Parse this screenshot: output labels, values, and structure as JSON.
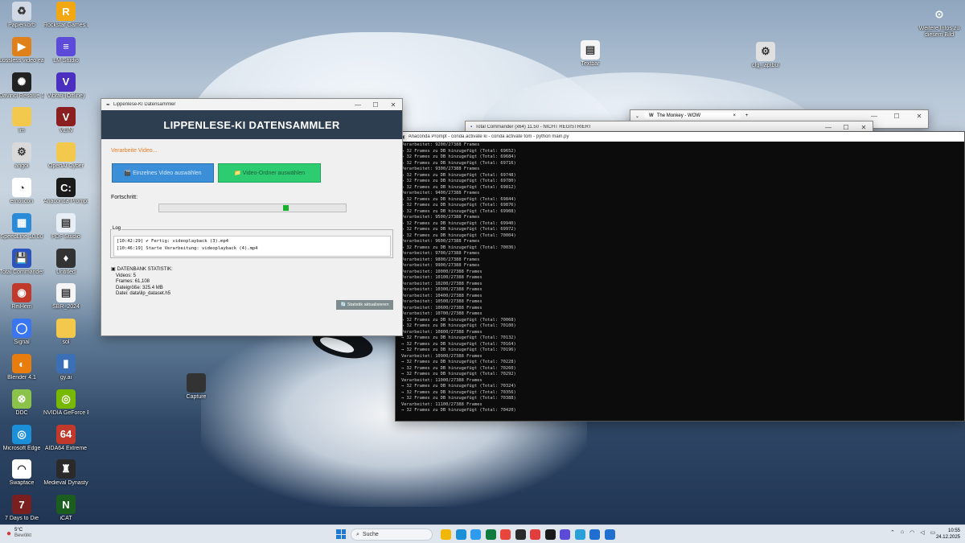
{
  "desktop": {
    "icons_left": [
      {
        "label": "Papierkorb",
        "glyph": "♻",
        "color": "#cfd8e3"
      },
      {
        "label": "Rockstar Games Launcher",
        "glyph": "R",
        "color": "#f3a712"
      },
      {
        "label": "Lossless video easy",
        "glyph": "▶",
        "color": "#e0801a"
      },
      {
        "label": "LM Studio",
        "glyph": "≡",
        "color": "#5b4bd8"
      },
      {
        "label": "Davinci Resolve 19",
        "glyph": "✺",
        "color": "#222222"
      },
      {
        "label": "Vibrati (Offline)",
        "glyph": "V",
        "color": "#4a2fc0"
      },
      {
        "label": "lm",
        "glyph": "",
        "color": "#f2c94c"
      },
      {
        "label": "VEIN",
        "glyph": "V",
        "color": "#8b1e1e"
      },
      {
        "label": "angoi",
        "glyph": "⚙",
        "color": "#d9d9d9"
      },
      {
        "label": "OpenAi Cyber",
        "glyph": "",
        "color": "#f2c94c"
      },
      {
        "label": "emoticon",
        "glyph": "◔",
        "color": "#ffffff"
      },
      {
        "label": "Anaconda Prompt",
        "glyph": "C:",
        "color": "#1a1a1a"
      },
      {
        "label": "SpeedLine 10.00",
        "glyph": "▦",
        "color": "#2a8bd8"
      },
      {
        "label": "PDF Studio",
        "glyph": "▤",
        "color": "#e8eef5"
      },
      {
        "label": "Total Commander",
        "glyph": "💾",
        "color": "#2a55c0"
      },
      {
        "label": "Untitled",
        "glyph": "♦",
        "color": "#333333"
      },
      {
        "label": "ReiHem",
        "glyph": "◉",
        "color": "#c0392b"
      },
      {
        "label": "SBR_2024",
        "glyph": "▤",
        "color": "#f5f5f5"
      },
      {
        "label": "Signal",
        "glyph": "◯",
        "color": "#3a76f0"
      },
      {
        "label": "sol",
        "glyph": "",
        "color": "#f2c94c"
      },
      {
        "label": "Blender 4.1",
        "glyph": "◐",
        "color": "#e87d0d"
      },
      {
        "label": "gy.ai",
        "glyph": "▮",
        "color": "#3b6fb6"
      },
      {
        "label": "DDC",
        "glyph": "⊗",
        "color": "#8bc34a"
      },
      {
        "label": "NVIDIA GeForce Experience",
        "glyph": "◎",
        "color": "#76b900"
      },
      {
        "label": "Microsoft Edge",
        "glyph": "◎",
        "color": "#1b8fd8"
      },
      {
        "label": "AIDA64 Extreme",
        "glyph": "64",
        "color": "#c0392b"
      },
      {
        "label": "Swapface",
        "glyph": "◠",
        "color": "#ffffff"
      },
      {
        "label": "Medieval Dynasty",
        "glyph": "♜",
        "color": "#2a2a2a"
      },
      {
        "label": "7 Days to Die",
        "glyph": "7",
        "color": "#7a1f1f"
      },
      {
        "label": "iCAT",
        "glyph": "N",
        "color": "#1b5e20"
      }
    ],
    "icons_right": [
      {
        "label": "Weitere Infos zu diesem Bild",
        "glyph": "⊙",
        "color": "#ffffff"
      },
      {
        "label": "Textbar",
        "glyph": "▤",
        "color": "#f5f5f5"
      },
      {
        "label": "cfg_laptbul",
        "glyph": "⚙",
        "color": "#e0e0e0"
      },
      {
        "label": "Capture",
        "glyph": "◉",
        "color": "#333333"
      }
    ]
  },
  "gui_window": {
    "title": "Lippenlese-KI Datensammler",
    "header": "LIPPENLESE-KI DATENSAMMLER",
    "status": "Verarbeite Video...",
    "button_single": "🎬 Einzelnes Video auswählen",
    "button_folder": "📁 Video-Ordner auswählen",
    "progress_label": "Fortschritt:",
    "progress_indeterminate_position": 0.68,
    "log_title": "Log",
    "log_lines": [
      "[10:42:29] ✔ Fertig: videoplayback (3).mp4",
      "[10:46:19] Starte Verarbeitung: videoplayback (4).mp4"
    ],
    "stats_title": "DATENBANK STATISTIK:",
    "stats_lines": [
      "Videos: 5",
      "Frames: 61,108",
      "Dateigröße: 325.4 MB",
      "Datei: data\\lip_dataset.h5"
    ],
    "refresh_button": "🔄 Statistik aktualisieren"
  },
  "browser_tab": {
    "title": "The Monkey - WOW",
    "close": "×",
    "new_tab": "+"
  },
  "total_commander": {
    "title": "Total Commander (x64) 11.50 - NICHT REGISTRIERT"
  },
  "terminal": {
    "title": "Anaconda Prompt - conda  activate ki - conda  activate tom - python  main.py",
    "lines": [
      "Verarbeitet: 9200/27388 Frames",
      "→ 32 Frames zu DB hinzugefügt (Total: 69652)",
      "→ 32 Frames zu DB hinzugefügt (Total: 69684)",
      "→ 32 Frames zu DB hinzugefügt (Total: 69716)",
      "Verarbeitet: 9300/27388 Frames",
      "→ 32 Frames zu DB hinzugefügt (Total: 69748)",
      "→ 32 Frames zu DB hinzugefügt (Total: 69780)",
      "→ 32 Frames zu DB hinzugefügt (Total: 69812)",
      "Verarbeitet: 9400/27388 Frames",
      "→ 32 Frames zu DB hinzugefügt (Total: 69844)",
      "→ 32 Frames zu DB hinzugefügt (Total: 69876)",
      "→ 32 Frames zu DB hinzugefügt (Total: 69908)",
      "Verarbeitet: 9500/27388 Frames",
      "→ 32 Frames zu DB hinzugefügt (Total: 69940)",
      "→ 32 Frames zu DB hinzugefügt (Total: 69972)",
      "→ 32 Frames zu DB hinzugefügt (Total: 70004)",
      "Verarbeitet: 9600/27388 Frames",
      "→ 32 Frames zu DB hinzugefügt (Total: 70036)",
      "Verarbeitet: 9700/27388 Frames",
      "Verarbeitet: 9800/27388 Frames",
      "Verarbeitet: 9900/27388 Frames",
      "Verarbeitet: 10000/27388 Frames",
      "Verarbeitet: 10100/27388 Frames",
      "Verarbeitet: 10200/27388 Frames",
      "Verarbeitet: 10300/27388 Frames",
      "Verarbeitet: 10400/27388 Frames",
      "Verarbeitet: 10500/27388 Frames",
      "Verarbeitet: 10600/27388 Frames",
      "Verarbeitet: 10700/27388 Frames",
      "→ 32 Frames zu DB hinzugefügt (Total: 70068)",
      "→ 32 Frames zu DB hinzugefügt (Total: 70100)",
      "Verarbeitet: 10800/27388 Frames",
      "→ 32 Frames zu DB hinzugefügt (Total: 70132)",
      "→ 32 Frames zu DB hinzugefügt (Total: 70164)",
      "→ 32 Frames zu DB hinzugefügt (Total: 70196)",
      "Verarbeitet: 10900/27388 Frames",
      "→ 32 Frames zu DB hinzugefügt (Total: 70228)",
      "→ 32 Frames zu DB hinzugefügt (Total: 70260)",
      "→ 32 Frames zu DB hinzugefügt (Total: 70292)",
      "Verarbeitet: 11000/27388 Frames",
      "→ 32 Frames zu DB hinzugefügt (Total: 70324)",
      "→ 32 Frames zu DB hinzugefügt (Total: 70356)",
      "→ 32 Frames zu DB hinzugefügt (Total: 70388)",
      "Verarbeitet: 11100/27388 Frames",
      "→ 32 Frames zu DB hinzugefügt (Total: 70420)"
    ]
  },
  "taskbar": {
    "weather_temp": "5°C",
    "weather_desc": "Bewölkt",
    "search_placeholder": "Suche",
    "time": "10:55",
    "date": "24.12.2025",
    "pinned": [
      "#f2b705",
      "#1b8fd8",
      "#2d9bf0",
      "#0f7b3f",
      "#e8453c",
      "#2a2a2a",
      "#e23d3d",
      "#1a1a1a",
      "#5b4bd8",
      "#2aa0d8",
      "#1f6fd0",
      "#1f6fd0"
    ]
  },
  "window_controls": {
    "minimize": "—",
    "maximize": "☐",
    "close": "✕"
  }
}
